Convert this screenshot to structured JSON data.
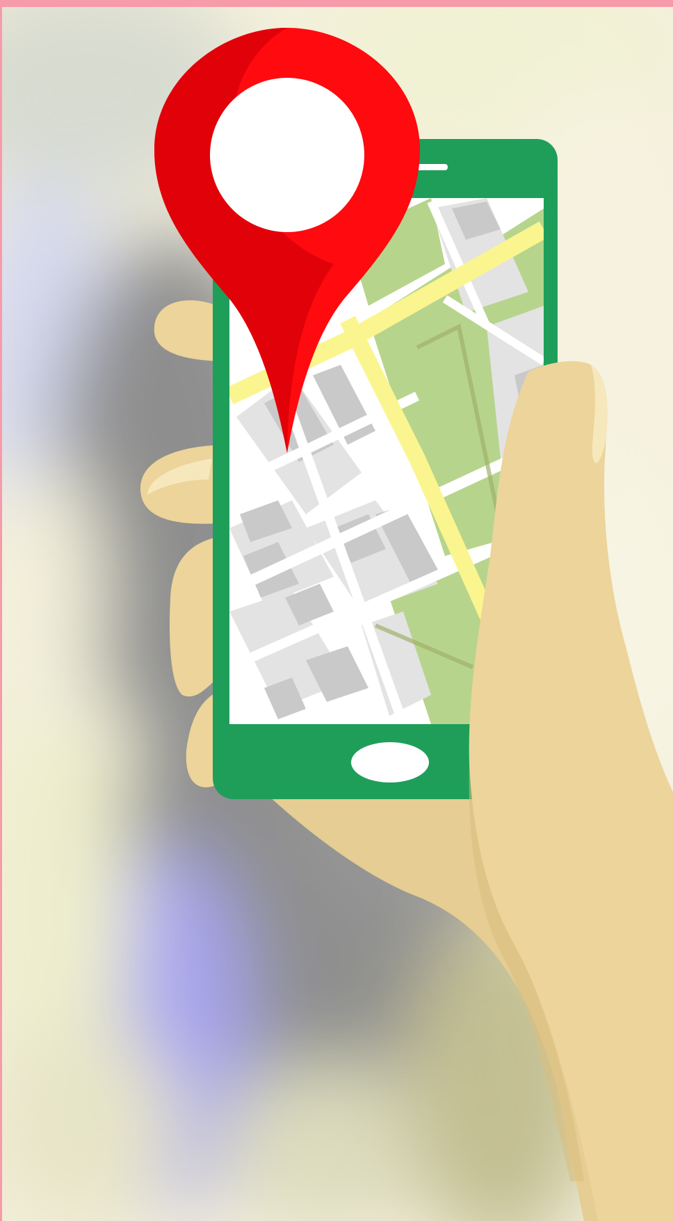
{
  "image": {
    "subject": "hand-holding-phone-with-map-and-location-pin",
    "colors": {
      "border_accent": "#f79aaa",
      "phone_green": "#1f9e5a",
      "pin_red": "#e5000a",
      "pin_red_dark": "#c40008",
      "skin": "#ecd49a",
      "skin_shadow": "#d9bd7e",
      "map_road_yellow": "#fbf58f",
      "map_park_green": "#b7d48d",
      "map_block_gray": "#e3e3e3",
      "map_building_gray": "#c9c9c9",
      "background_gray": "#9b9b9b",
      "background_purple": "#a9a7ee",
      "background_cream": "#f3efd6"
    },
    "icons": [
      "location-pin-icon",
      "smartphone-icon",
      "map-icon",
      "hand-icon"
    ]
  }
}
